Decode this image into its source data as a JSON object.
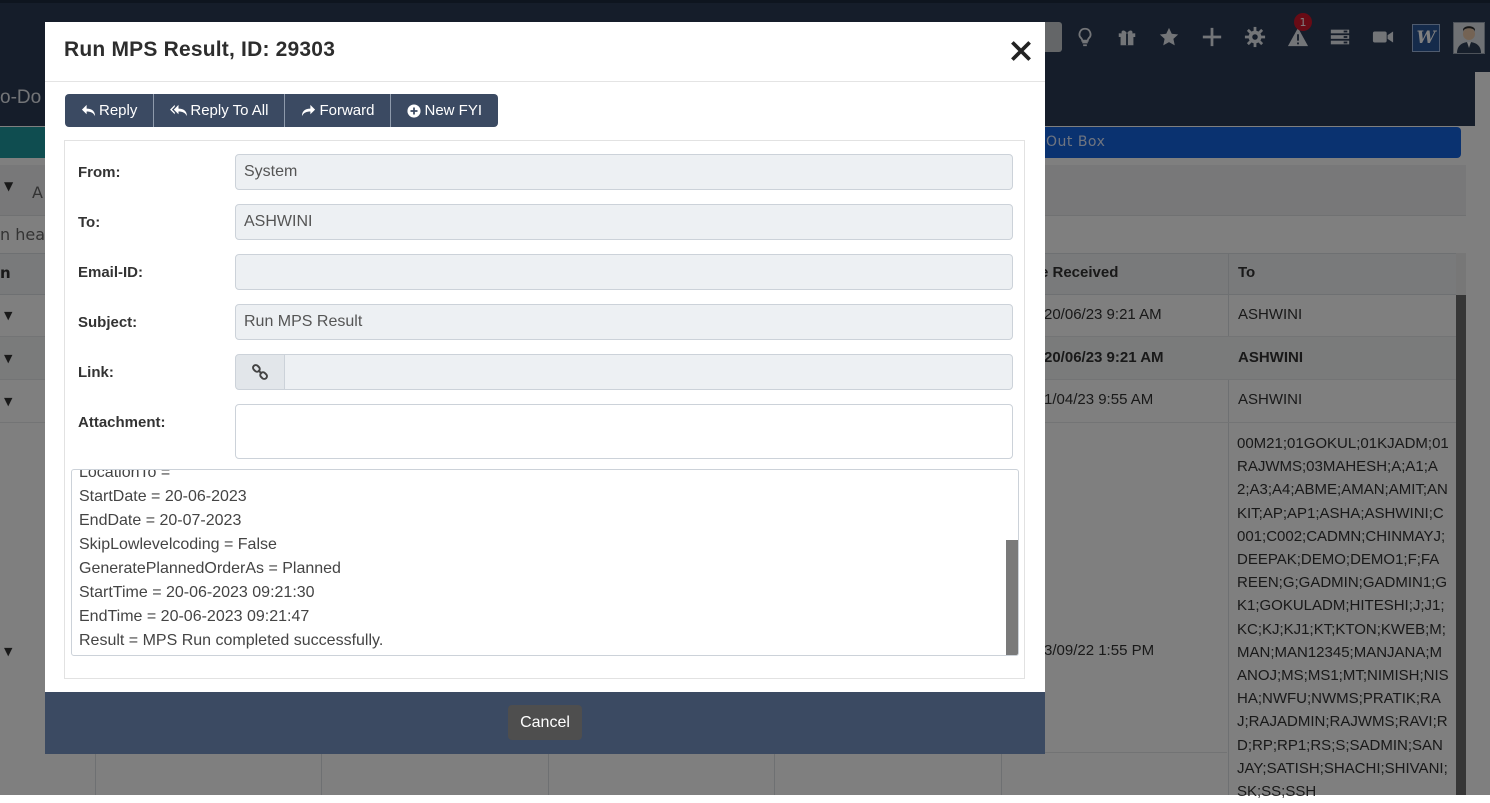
{
  "background": {
    "page_title_fragment": "o-Do",
    "outbox_tab": "Out Box",
    "filter_fragment": "A",
    "hint_fragment": "n head",
    "alert_badge_count": "1",
    "word_icon_letter": "W",
    "grid": {
      "col_left_fragment": "n",
      "col_received": "e Received",
      "col_to": "To",
      "rows": [
        {
          "date": "20/06/23 9:21 AM",
          "to": "ASHWINI",
          "bold": false
        },
        {
          "date": "20/06/23 9:21 AM",
          "to": "ASHWINI",
          "bold": true
        },
        {
          "date": "1/04/23 9:55 AM",
          "to": "ASHWINI",
          "bold": false
        },
        {
          "date": "3/09/22 1:55 PM",
          "to": "00M21;01GOKUL;01KJADM;01RAJWMS;03MAHESH;A;A1;A2;A3;A4;ABME;AMAN;AMIT;ANKIT;AP;AP1;ASHA;ASHWINI;C001;C002;CADMN;CHINMAYJ;DEEPAK;DEMO;DEMO1;F;FAREEN;G;GADMIN;GADMIN1;GK1;GOKULADM;HITESHI;J;J1;KC;KJ;KJ1;KT;KTON;KWEB;M;MAN;MAN12345;MANJANA;MANOJ;MS;MS1;MT;NIMISH;NISHA;NWFU;NWMS;PRATIK;RAJ;RAJADMIN;RAJWMS;RAVI;RD;RP;RP1;RS;S;SADMIN;SANJAY;SATISH;SHACHI;SHIVANI;SK;SS;SSH",
          "bold": false
        }
      ]
    }
  },
  "modal": {
    "title": "Run MPS Result, ID: 29303",
    "close_symbol": "✕",
    "buttons": {
      "reply": "Reply",
      "reply_all": "Reply To All",
      "forward": "Forward",
      "new_fyi": "New FYI"
    },
    "fields": {
      "from_label": "From:",
      "from_value": "System",
      "to_label": "To:",
      "to_value": "ASHWINI",
      "email_label": "Email-ID:",
      "email_value": "",
      "subject_label": "Subject:",
      "subject_value": "Run MPS Result",
      "link_label": "Link:",
      "link_value": "",
      "attachment_label": "Attachment:"
    },
    "body_lines": [
      "LocationTo =",
      "StartDate = 20-06-2023",
      "EndDate = 20-07-2023",
      "SkipLowlevelcoding = False",
      "GeneratePlannedOrderAs = Planned",
      "StartTime = 20-06-2023 09:21:30",
      "EndTime = 20-06-2023 09:21:47",
      "Result = MPS Run completed successfully."
    ],
    "cancel_label": "Cancel"
  },
  "icons": {
    "toolbar": [
      "lightbulb-icon",
      "gift-icon",
      "star-icon",
      "plus-icon",
      "gear-icon",
      "alert-icon",
      "server-icon",
      "video-camera-icon",
      "word-icon",
      "user-avatar"
    ],
    "reply": "reply-icon",
    "reply_all": "reply-all-icon",
    "forward": "forward-icon",
    "new_fyi": "plus-circle-icon",
    "link": "chain-link-icon"
  },
  "colors": {
    "navbar": "#2a3a54",
    "modal_footer": "#3b4a62",
    "button": "#3b4a62",
    "outbox_tab": "#1565e0",
    "teal_tab": "#1f9aa0",
    "badge": "#d0162b",
    "cancel_button": "#4e4e4e"
  }
}
